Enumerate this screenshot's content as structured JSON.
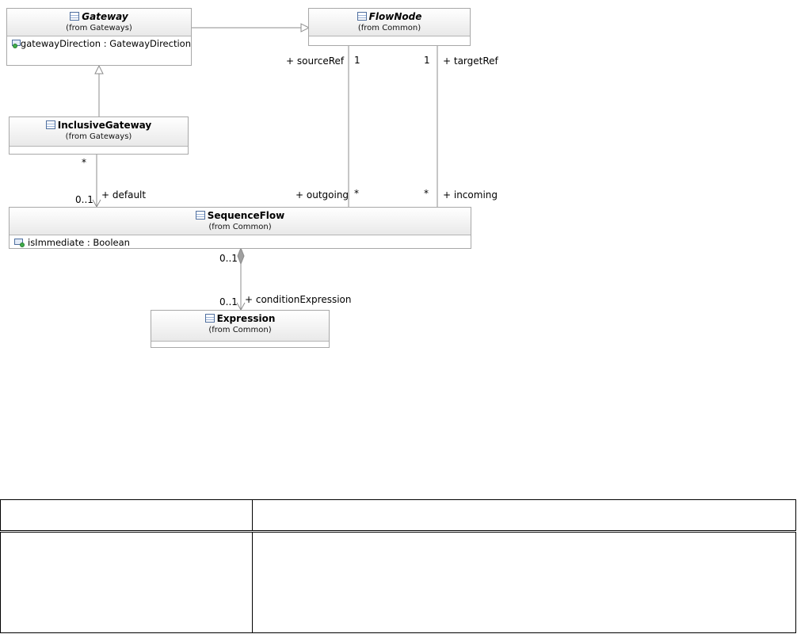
{
  "diagram": {
    "classes": {
      "gateway": {
        "name": "Gateway",
        "stereotype": "(from Gateways)",
        "attributes": [
          "gatewayDirection : GatewayDirection"
        ]
      },
      "flownode": {
        "name": "FlowNode",
        "stereotype": "(from Common)",
        "attributes": []
      },
      "inclusivegateway": {
        "name": "InclusiveGateway",
        "stereotype": "(from Gateways)",
        "attributes": []
      },
      "sequenceflow": {
        "name": "SequenceFlow",
        "stereotype": "(from Common)",
        "attributes": [
          "isImmediate : Boolean"
        ]
      },
      "expression": {
        "name": "Expression",
        "stereotype": "(from Common)",
        "attributes": []
      }
    },
    "labels": {
      "source_ref": "+ sourceRef",
      "source_ref_mult": "1",
      "target_ref_mult": "1",
      "target_ref": "+ targetRef",
      "inclusive_star": "*",
      "default_mult": "0..1",
      "default": "+ default",
      "outgoing": "+ outgoing",
      "outgoing_mult": "*",
      "incoming_mult": "*",
      "incoming": "+ incoming",
      "composition_mult_top": "0..1",
      "composition_mult_bottom": "0..1",
      "condition_expression": "+ conditionExpression"
    }
  },
  "table": {
    "header": [
      "",
      ""
    ],
    "rows": [
      [
        "",
        ""
      ]
    ]
  }
}
